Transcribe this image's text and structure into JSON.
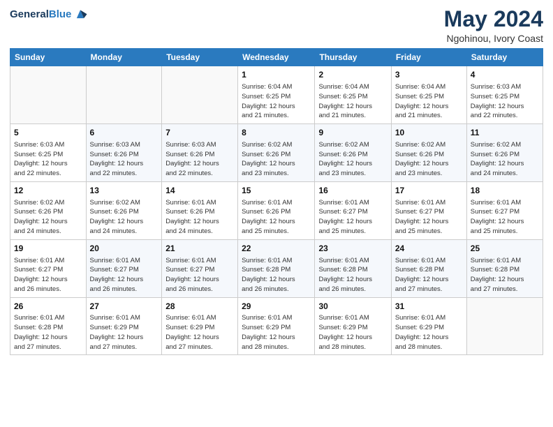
{
  "header": {
    "logo_line1": "General",
    "logo_line2": "Blue",
    "main_title": "May 2024",
    "subtitle": "Ngohinou, Ivory Coast"
  },
  "columns": [
    "Sunday",
    "Monday",
    "Tuesday",
    "Wednesday",
    "Thursday",
    "Friday",
    "Saturday"
  ],
  "weeks": [
    [
      {
        "day": "",
        "info": ""
      },
      {
        "day": "",
        "info": ""
      },
      {
        "day": "",
        "info": ""
      },
      {
        "day": "1",
        "info": "Sunrise: 6:04 AM\nSunset: 6:25 PM\nDaylight: 12 hours\nand 21 minutes."
      },
      {
        "day": "2",
        "info": "Sunrise: 6:04 AM\nSunset: 6:25 PM\nDaylight: 12 hours\nand 21 minutes."
      },
      {
        "day": "3",
        "info": "Sunrise: 6:04 AM\nSunset: 6:25 PM\nDaylight: 12 hours\nand 21 minutes."
      },
      {
        "day": "4",
        "info": "Sunrise: 6:03 AM\nSunset: 6:25 PM\nDaylight: 12 hours\nand 22 minutes."
      }
    ],
    [
      {
        "day": "5",
        "info": "Sunrise: 6:03 AM\nSunset: 6:25 PM\nDaylight: 12 hours\nand 22 minutes."
      },
      {
        "day": "6",
        "info": "Sunrise: 6:03 AM\nSunset: 6:26 PM\nDaylight: 12 hours\nand 22 minutes."
      },
      {
        "day": "7",
        "info": "Sunrise: 6:03 AM\nSunset: 6:26 PM\nDaylight: 12 hours\nand 22 minutes."
      },
      {
        "day": "8",
        "info": "Sunrise: 6:02 AM\nSunset: 6:26 PM\nDaylight: 12 hours\nand 23 minutes."
      },
      {
        "day": "9",
        "info": "Sunrise: 6:02 AM\nSunset: 6:26 PM\nDaylight: 12 hours\nand 23 minutes."
      },
      {
        "day": "10",
        "info": "Sunrise: 6:02 AM\nSunset: 6:26 PM\nDaylight: 12 hours\nand 23 minutes."
      },
      {
        "day": "11",
        "info": "Sunrise: 6:02 AM\nSunset: 6:26 PM\nDaylight: 12 hours\nand 24 minutes."
      }
    ],
    [
      {
        "day": "12",
        "info": "Sunrise: 6:02 AM\nSunset: 6:26 PM\nDaylight: 12 hours\nand 24 minutes."
      },
      {
        "day": "13",
        "info": "Sunrise: 6:02 AM\nSunset: 6:26 PM\nDaylight: 12 hours\nand 24 minutes."
      },
      {
        "day": "14",
        "info": "Sunrise: 6:01 AM\nSunset: 6:26 PM\nDaylight: 12 hours\nand 24 minutes."
      },
      {
        "day": "15",
        "info": "Sunrise: 6:01 AM\nSunset: 6:26 PM\nDaylight: 12 hours\nand 25 minutes."
      },
      {
        "day": "16",
        "info": "Sunrise: 6:01 AM\nSunset: 6:27 PM\nDaylight: 12 hours\nand 25 minutes."
      },
      {
        "day": "17",
        "info": "Sunrise: 6:01 AM\nSunset: 6:27 PM\nDaylight: 12 hours\nand 25 minutes."
      },
      {
        "day": "18",
        "info": "Sunrise: 6:01 AM\nSunset: 6:27 PM\nDaylight: 12 hours\nand 25 minutes."
      }
    ],
    [
      {
        "day": "19",
        "info": "Sunrise: 6:01 AM\nSunset: 6:27 PM\nDaylight: 12 hours\nand 26 minutes."
      },
      {
        "day": "20",
        "info": "Sunrise: 6:01 AM\nSunset: 6:27 PM\nDaylight: 12 hours\nand 26 minutes."
      },
      {
        "day": "21",
        "info": "Sunrise: 6:01 AM\nSunset: 6:27 PM\nDaylight: 12 hours\nand 26 minutes."
      },
      {
        "day": "22",
        "info": "Sunrise: 6:01 AM\nSunset: 6:28 PM\nDaylight: 12 hours\nand 26 minutes."
      },
      {
        "day": "23",
        "info": "Sunrise: 6:01 AM\nSunset: 6:28 PM\nDaylight: 12 hours\nand 26 minutes."
      },
      {
        "day": "24",
        "info": "Sunrise: 6:01 AM\nSunset: 6:28 PM\nDaylight: 12 hours\nand 27 minutes."
      },
      {
        "day": "25",
        "info": "Sunrise: 6:01 AM\nSunset: 6:28 PM\nDaylight: 12 hours\nand 27 minutes."
      }
    ],
    [
      {
        "day": "26",
        "info": "Sunrise: 6:01 AM\nSunset: 6:28 PM\nDaylight: 12 hours\nand 27 minutes."
      },
      {
        "day": "27",
        "info": "Sunrise: 6:01 AM\nSunset: 6:29 PM\nDaylight: 12 hours\nand 27 minutes."
      },
      {
        "day": "28",
        "info": "Sunrise: 6:01 AM\nSunset: 6:29 PM\nDaylight: 12 hours\nand 27 minutes."
      },
      {
        "day": "29",
        "info": "Sunrise: 6:01 AM\nSunset: 6:29 PM\nDaylight: 12 hours\nand 28 minutes."
      },
      {
        "day": "30",
        "info": "Sunrise: 6:01 AM\nSunset: 6:29 PM\nDaylight: 12 hours\nand 28 minutes."
      },
      {
        "day": "31",
        "info": "Sunrise: 6:01 AM\nSunset: 6:29 PM\nDaylight: 12 hours\nand 28 minutes."
      },
      {
        "day": "",
        "info": ""
      }
    ]
  ]
}
